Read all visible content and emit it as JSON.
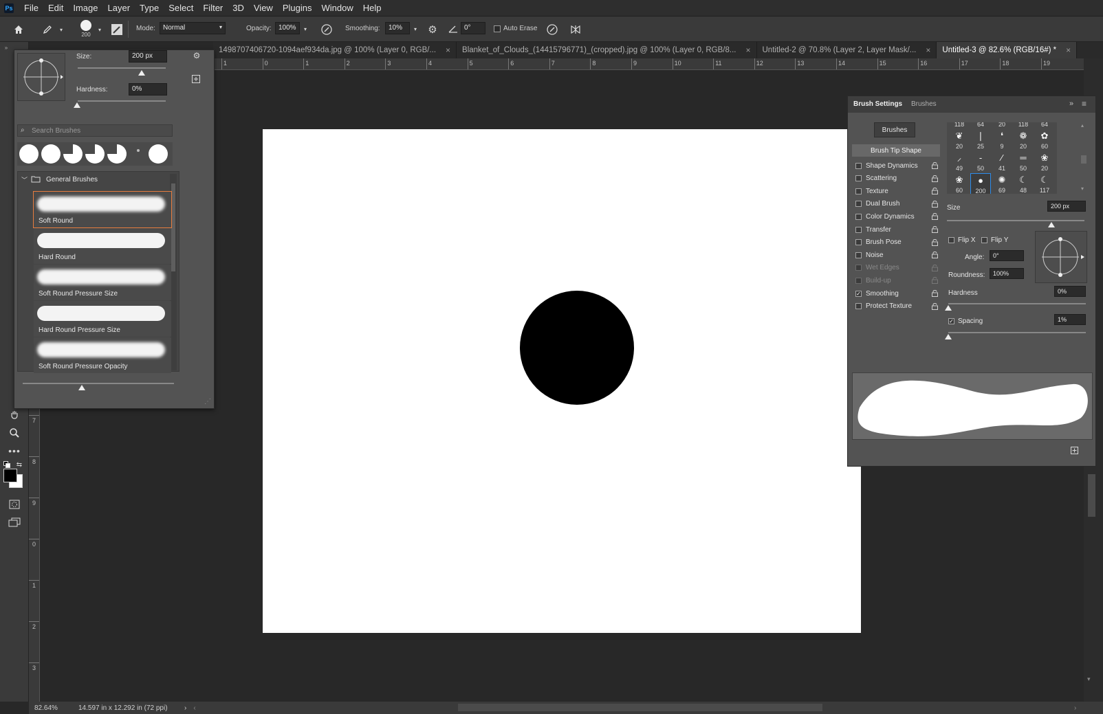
{
  "app": {
    "logo_text": "Ps"
  },
  "menu": [
    "File",
    "Edit",
    "Image",
    "Layer",
    "Type",
    "Select",
    "Filter",
    "3D",
    "View",
    "Plugins",
    "Window",
    "Help"
  ],
  "options_bar": {
    "brush_size_preview": "200",
    "mode_label": "Mode:",
    "mode_value": "Normal",
    "opacity_label": "Opacity:",
    "opacity_value": "100%",
    "smoothing_label": "Smoothing:",
    "smoothing_value": "10%",
    "angle_value": "0°",
    "auto_erase_label": "Auto Erase"
  },
  "tabs": [
    {
      "label": "1498707406720-1094aef934da.jpg @ 100% (Layer 0, RGB/...",
      "active": false
    },
    {
      "label": "Blanket_of_Clouds_(14415796771)_(cropped).jpg @ 100% (Layer 0, RGB/8...",
      "active": false
    },
    {
      "label": "Untitled-2 @ 70.8% (Layer 2, Layer Mask/...",
      "active": false
    },
    {
      "label": "Untitled-3 @ 82.6% (RGB/16#) *",
      "active": true
    }
  ],
  "ruler_h_labels": [
    "1",
    "0",
    "1",
    "2",
    "3",
    "4",
    "5",
    "6",
    "7",
    "8",
    "9",
    "10",
    "11",
    "12",
    "13",
    "14",
    "15",
    "16",
    "17",
    "18",
    "19"
  ],
  "ruler_v_labels": [
    "7",
    "8",
    "9",
    "0",
    "1",
    "2",
    "3"
  ],
  "brush_popup": {
    "size_label": "Size:",
    "size_value": "200 px",
    "hardness_label": "Hardness:",
    "hardness_value": "0%",
    "search_placeholder": "Search Brushes",
    "group_name": "General Brushes",
    "brushes": [
      {
        "name": "Soft Round",
        "soft": true,
        "selected": true
      },
      {
        "name": "Hard Round",
        "soft": false,
        "selected": false
      },
      {
        "name": "Soft Round Pressure Size",
        "soft": true,
        "selected": false
      },
      {
        "name": "Hard Round Pressure Size",
        "soft": false,
        "selected": false
      },
      {
        "name": "Soft Round Pressure Opacity",
        "soft": true,
        "selected": false
      }
    ]
  },
  "brush_settings": {
    "tab_active": "Brush Settings",
    "tab_other": "Brushes",
    "brushes_button": "Brushes",
    "brush_tip_shape": "Brush Tip Shape",
    "options": [
      {
        "label": "Shape Dynamics",
        "checked": false,
        "disabled": false
      },
      {
        "label": "Scattering",
        "checked": false,
        "disabled": false
      },
      {
        "label": "Texture",
        "checked": false,
        "disabled": false
      },
      {
        "label": "Dual Brush",
        "checked": false,
        "disabled": false
      },
      {
        "label": "Color Dynamics",
        "checked": false,
        "disabled": false
      },
      {
        "label": "Transfer",
        "checked": false,
        "disabled": false
      },
      {
        "label": "Brush Pose",
        "checked": false,
        "disabled": false
      },
      {
        "label": "Noise",
        "checked": false,
        "disabled": false
      },
      {
        "label": "Wet Edges",
        "checked": false,
        "disabled": true
      },
      {
        "label": "Build-up",
        "checked": false,
        "disabled": true
      },
      {
        "label": "Smoothing",
        "checked": true,
        "disabled": false
      },
      {
        "label": "Protect Texture",
        "checked": false,
        "disabled": false
      }
    ],
    "tip_rows": [
      [
        "118",
        "64",
        "20",
        "118",
        "64"
      ],
      [
        "20",
        "25",
        "9",
        "20",
        "60"
      ],
      [
        "49",
        "50",
        "41",
        "50",
        "20"
      ],
      [
        "60",
        "200",
        "69",
        "48",
        "117"
      ]
    ],
    "size_label": "Size",
    "size_value": "200 px",
    "flip_x_label": "Flip X",
    "flip_y_label": "Flip Y",
    "angle_label": "Angle:",
    "angle_value": "0°",
    "roundness_label": "Roundness:",
    "roundness_value": "100%",
    "hardness_label": "Hardness",
    "hardness_value": "0%",
    "spacing_label": "Spacing",
    "spacing_value": "1%"
  },
  "status": {
    "zoom": "82.64%",
    "doc_info": "14.597 in x 12.292 in (72 ppi)"
  },
  "colors": {
    "foreground": "#000000",
    "background": "#ffffff",
    "accent": "#e87d3e",
    "tip_selected": "#2d8ceb"
  }
}
